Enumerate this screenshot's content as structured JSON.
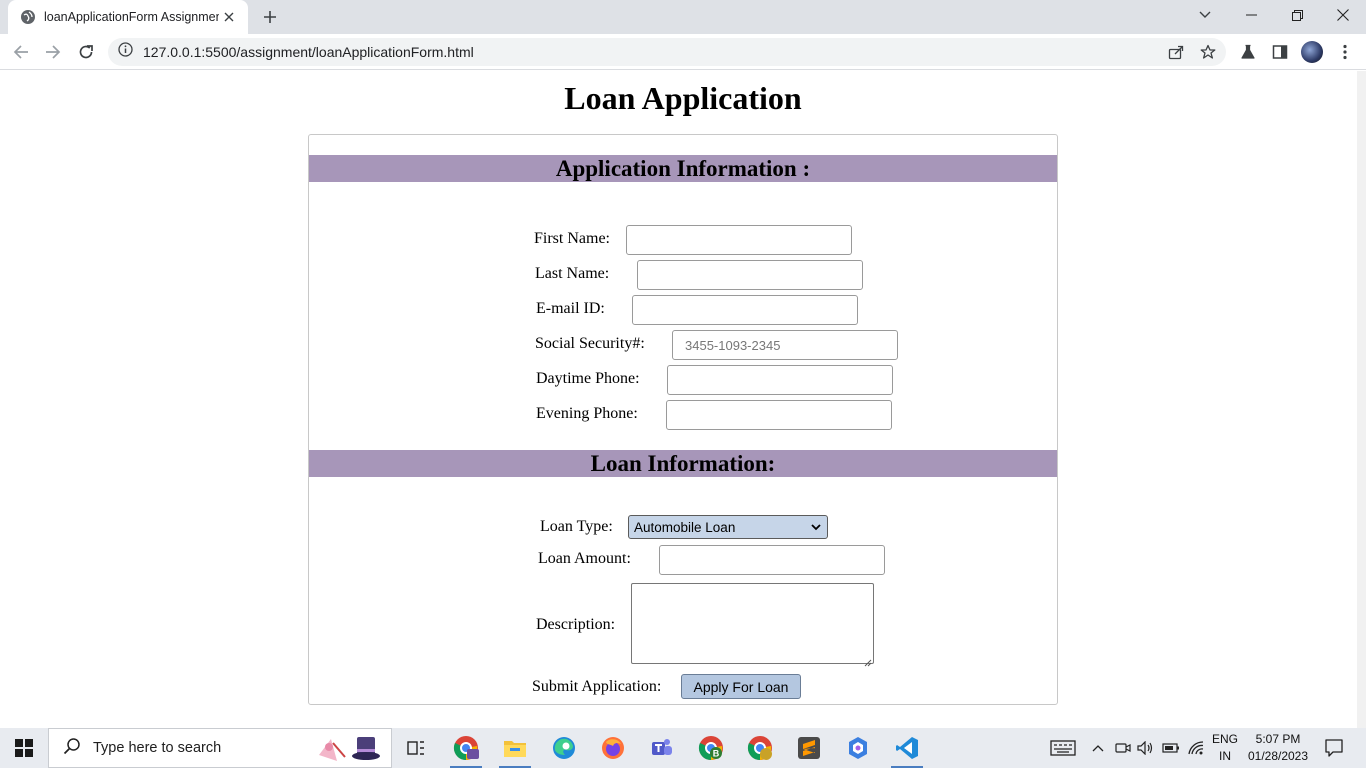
{
  "browser": {
    "tab_title": "loanApplicationForm Assignment",
    "url": "127.0.0.1:5500/assignment/loanApplicationForm.html"
  },
  "page": {
    "title": "Loan Application"
  },
  "application_section": {
    "heading": "Application Information :",
    "first_name_label": "First Name:",
    "last_name_label": "Last Name:",
    "email_label": "E-mail ID:",
    "ssn_label": "Social Security#:",
    "ssn_placeholder": "3455-1093-2345",
    "daytime_phone_label": "Daytime Phone:",
    "evening_phone_label": "Evening Phone:"
  },
  "loan_section": {
    "heading": "Loan Information:",
    "loan_type_label": "Loan Type:",
    "loan_type_selected": "Automobile Loan",
    "loan_amount_label": "Loan Amount:",
    "description_label": "Description:",
    "submit_label": "Submit Application:",
    "apply_button": "Apply For Loan"
  },
  "taskbar": {
    "search_placeholder": "Type here to search",
    "language_top": "ENG",
    "language_bottom": "IN",
    "time": "5:07 PM",
    "date": "01/28/2023"
  },
  "colors": {
    "section_header": "#a796b9",
    "select_bg": "#c6d5e8",
    "button_bg": "#b4c7e0"
  }
}
